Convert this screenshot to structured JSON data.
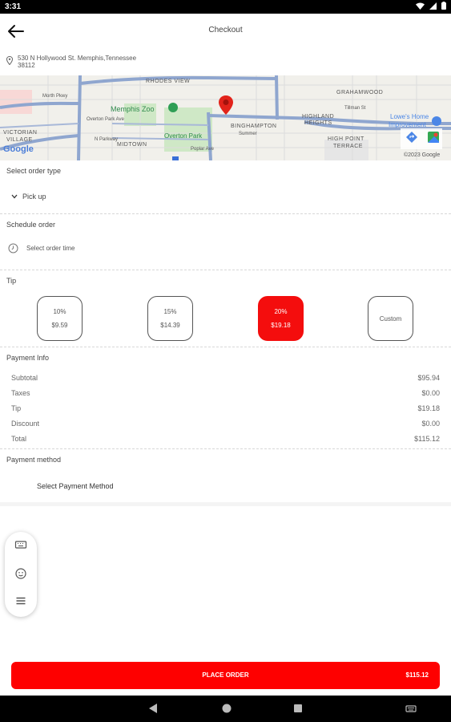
{
  "status_bar": {
    "time": "3:31"
  },
  "header": {
    "title": "Checkout"
  },
  "address": {
    "line1": "530 N Hollywood St. Memphis,Tennessee",
    "line2": "38112"
  },
  "map": {
    "labels": {
      "rhodes_view": "RHODES VIEW",
      "grahamwood": "GRAHAMWOOD",
      "morth_pkwy": "Morth Pkwy",
      "memphis_zoo": "Memphis Zoo",
      "overton_park_ave": "Overton Park Ave",
      "highland": "HIGHLAND",
      "heights": "HEIGHTS",
      "tillman_st": "Tillman St",
      "binghampton": "BINGHAMPTON",
      "lowes_1": "Lowe's Home",
      "lowes_2": "Improvement",
      "victorian": "VICTORIAN",
      "village": "VILLAGE",
      "midtown": "MIDTOWN",
      "overton_park": "Overton Park",
      "poplar_ave": "Poplar Ave",
      "n_parkway": "N Parkway",
      "summer": "Summer",
      "high_point_1": "HIGH POINT",
      "high_point_2": "TERRACE",
      "google": "Google",
      "copyright": "©2023 Google"
    }
  },
  "order_type": {
    "label": "Select order type",
    "value": "Pick up"
  },
  "schedule": {
    "label": "Schedule order",
    "placeholder": "Select order time"
  },
  "tip": {
    "label": "Tip",
    "options": [
      {
        "pct": "10%",
        "amount": "$9.59"
      },
      {
        "pct": "15%",
        "amount": "$14.39"
      },
      {
        "pct": "20%",
        "amount": "$19.18"
      },
      {
        "pct": "Custom",
        "amount": ""
      }
    ],
    "selected_index": 2
  },
  "payment_info": {
    "label": "Payment Info",
    "rows": [
      {
        "label": "Subtotal",
        "value": "$95.94"
      },
      {
        "label": "Taxes",
        "value": "$0.00"
      },
      {
        "label": "Tip",
        "value": "$19.18"
      },
      {
        "label": "Discount",
        "value": "$0.00"
      },
      {
        "label": "Total",
        "value": "$115.12"
      }
    ]
  },
  "payment_method": {
    "label": "Payment method",
    "select_label": "Select Payment Method"
  },
  "floating_menu": {
    "icons": [
      "keyboard-icon",
      "emoji-icon",
      "menu-icon"
    ]
  },
  "place_order": {
    "label": "PLACE ORDER",
    "amount": "$115.12"
  },
  "colors": {
    "accent": "#fe0000",
    "tip_active": "#f40d0d",
    "map_road": "#8fa6cf"
  }
}
